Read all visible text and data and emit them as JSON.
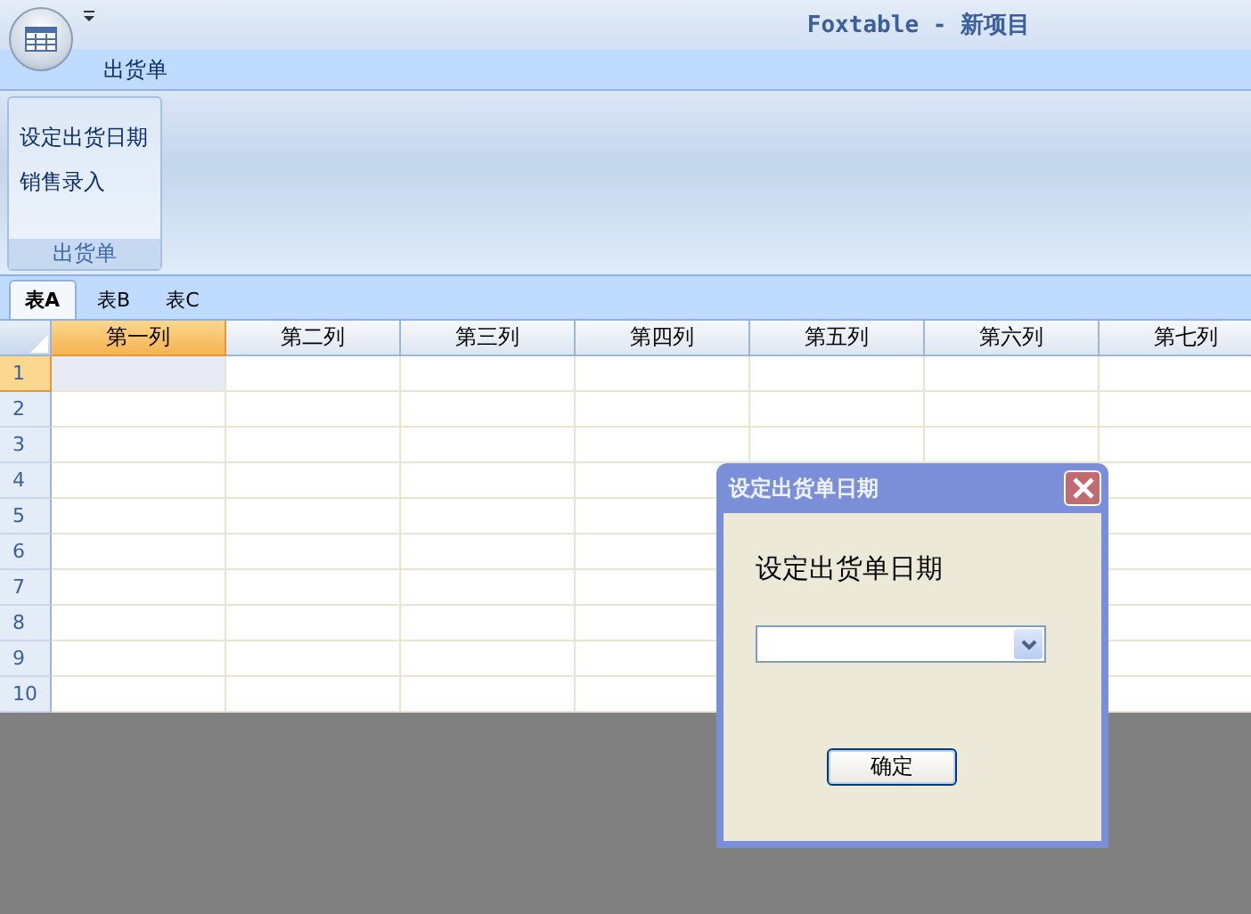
{
  "window": {
    "title": "Foxtable - 新项目"
  },
  "ribbon": {
    "tabs": [
      {
        "label": "出货单",
        "selected": true
      }
    ],
    "groups": [
      {
        "label": "出货单",
        "items": [
          "设定出货日期",
          "销售录入"
        ]
      }
    ]
  },
  "sheet_tabs": [
    {
      "label": "表A",
      "selected": true
    },
    {
      "label": "表B",
      "selected": false
    },
    {
      "label": "表C",
      "selected": false
    }
  ],
  "table": {
    "columns": [
      {
        "label": "第一列",
        "selected": true
      },
      {
        "label": "第二列",
        "selected": false
      },
      {
        "label": "第三列",
        "selected": false
      },
      {
        "label": "第四列",
        "selected": false
      },
      {
        "label": "第五列",
        "selected": false
      },
      {
        "label": "第六列",
        "selected": false
      },
      {
        "label": "第七列",
        "selected": false
      }
    ],
    "rows": [
      {
        "number": "1",
        "selected": true
      },
      {
        "number": "2",
        "selected": false
      },
      {
        "number": "3",
        "selected": false
      },
      {
        "number": "4",
        "selected": false
      },
      {
        "number": "5",
        "selected": false
      },
      {
        "number": "6",
        "selected": false
      },
      {
        "number": "7",
        "selected": false
      },
      {
        "number": "8",
        "selected": false
      },
      {
        "number": "9",
        "selected": false
      },
      {
        "number": "10",
        "selected": false
      }
    ]
  },
  "dialog": {
    "title": "设定出货单日期",
    "prompt": "设定出货单日期",
    "ok_button": "确定"
  }
}
